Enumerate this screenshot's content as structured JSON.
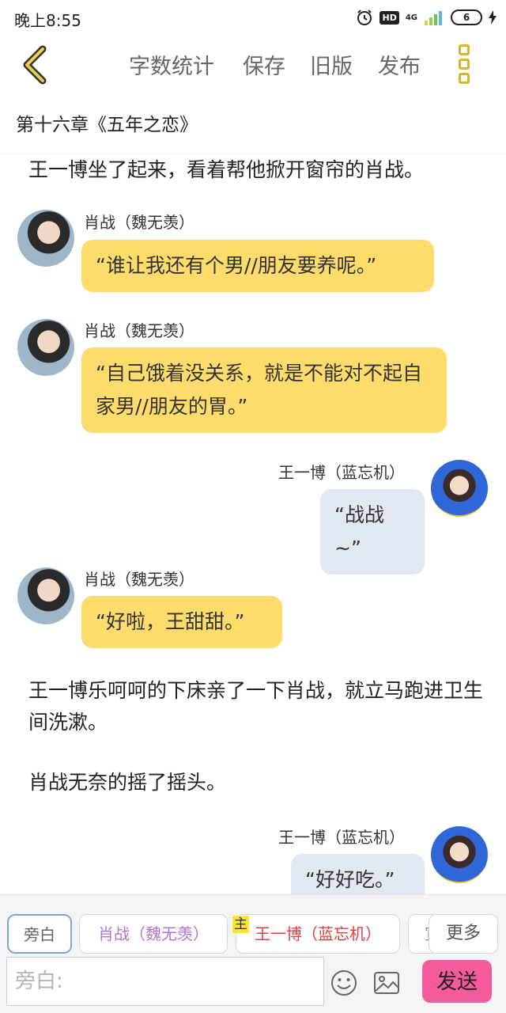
{
  "status_bar": {
    "time": "晚上8:55",
    "hd": "HD",
    "network": "4G",
    "battery": "6"
  },
  "toolbar": {
    "word_count": "字数统计",
    "save": "保存",
    "old_version": "旧版",
    "publish": "发布"
  },
  "chapter": {
    "title": "第十六章《五年之恋》"
  },
  "messages": [
    {
      "type": "narration",
      "text": "王一博坐了起来，看着帮他掀开窗帘的肖战。"
    },
    {
      "type": "dialog",
      "side": "left",
      "speaker": "肖战（魏无羡）",
      "text": "“谁让我还有个男//朋友要养呢。”"
    },
    {
      "type": "dialog",
      "side": "left",
      "speaker": "肖战（魏无羡）",
      "text": "“自己饿着没关系，就是不能对不起自家男//朋友的胃。”"
    },
    {
      "type": "dialog",
      "side": "right",
      "speaker": "王一博（蓝忘机）",
      "text": "“战战~”"
    },
    {
      "type": "dialog",
      "side": "left",
      "speaker": "肖战（魏无羡）",
      "text": "“好啦，王甜甜。”"
    },
    {
      "type": "narration",
      "text": "王一博乐呵呵的下床亲了一下肖战，就立马跑进卫生间洗漱。"
    },
    {
      "type": "narration",
      "text": "肖战无奈的摇了摇头。"
    },
    {
      "type": "dialog",
      "side": "right",
      "speaker": "王一博（蓝忘机）",
      "text": "“好好吃。”"
    }
  ],
  "roles": {
    "narrator": "旁白",
    "xiao_zhan": "肖战（魏无羡）",
    "main_tag": "主",
    "wang_yibo": "王一博（蓝忘机）",
    "partial": "宣",
    "more": "更多"
  },
  "input": {
    "placeholder": "旁白:",
    "value": ""
  },
  "send_label": "发送",
  "colors": {
    "accent_yellow": "#fddc6b",
    "bubble_gray": "#e2e8f1",
    "send_pink": "#f55b9b",
    "icon_gold": "#d8b62c"
  }
}
